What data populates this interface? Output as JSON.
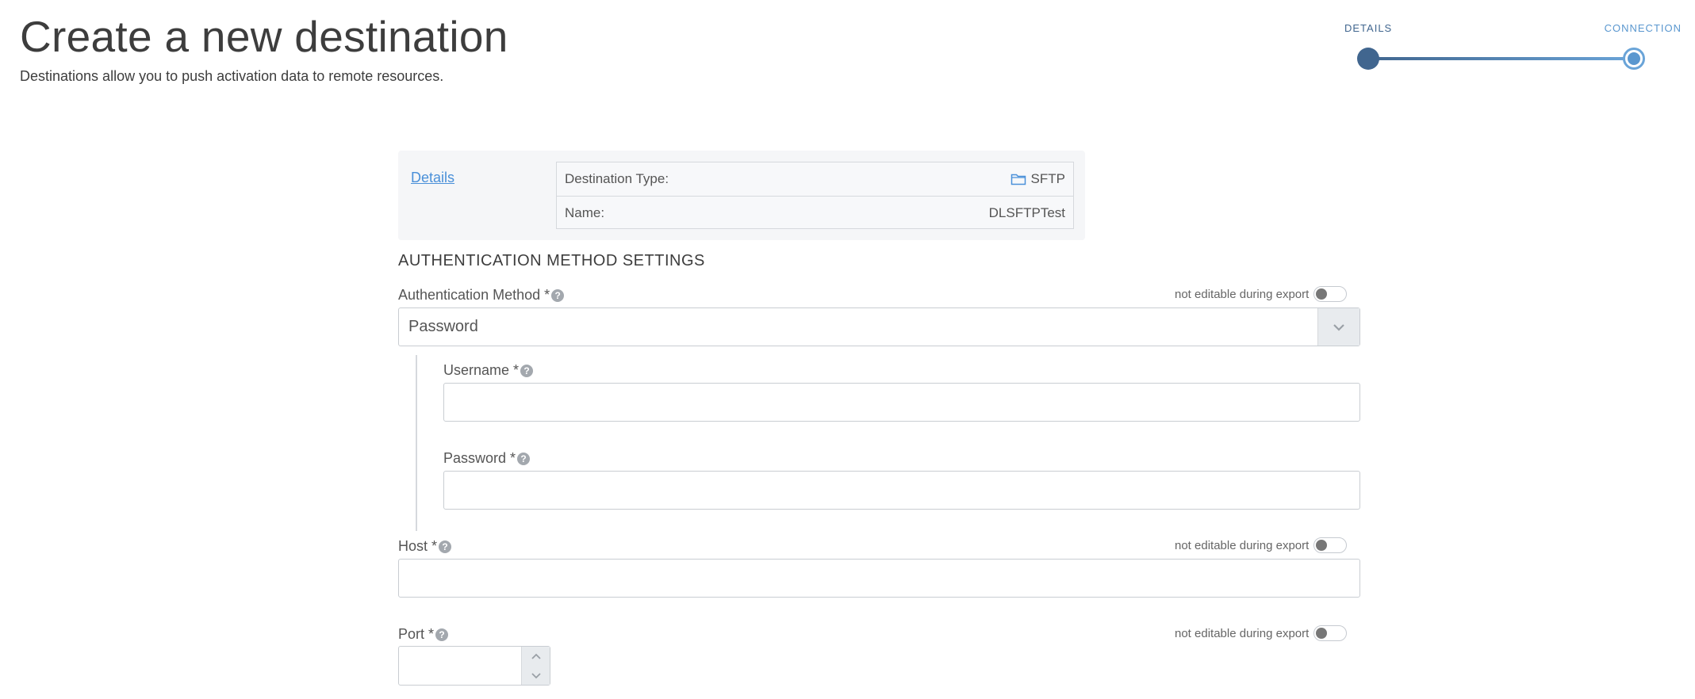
{
  "header": {
    "title": "Create a new destination",
    "subtitle": "Destinations allow you to push activation data to remote resources."
  },
  "stepper": {
    "steps": [
      {
        "label": "DETAILS",
        "state": "completed"
      },
      {
        "label": "CONNECTION",
        "state": "current"
      }
    ]
  },
  "summary": {
    "link_label": "Details",
    "rows": [
      {
        "label": "Destination Type:",
        "value": "SFTP",
        "icon": "folder-icon"
      },
      {
        "label": "Name:",
        "value": "DLSFTPTest"
      }
    ]
  },
  "section": {
    "title": "AUTHENTICATION METHOD SETTINGS"
  },
  "fields": {
    "auth_method": {
      "label": "Authentication Method *",
      "value": "Password",
      "lock_label": "not editable during export"
    },
    "username": {
      "label": "Username *",
      "value": ""
    },
    "password": {
      "label": "Password *",
      "value": ""
    },
    "host": {
      "label": "Host *",
      "value": "",
      "lock_label": "not editable during export"
    },
    "port": {
      "label": "Port *",
      "value": "",
      "lock_label": "not editable during export"
    }
  },
  "colors": {
    "accent": "#41668f",
    "link": "#4a90d9",
    "step_current": "#5a97cf"
  }
}
